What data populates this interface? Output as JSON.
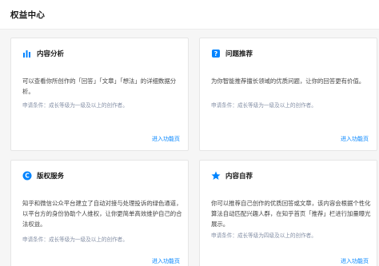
{
  "header": {
    "title": "权益中心"
  },
  "cards": [
    {
      "title": "内容分析",
      "icon": "bar-chart-icon",
      "desc": "可以查看你所创作的「回答」「文章」「想法」的详细数据分析。",
      "condition": "申请条件：成长等级为一级及以上的创作者。",
      "link": "进入功能页"
    },
    {
      "title": "问题推荐",
      "icon": "question-icon",
      "desc": "为你智能推荐擅长领域的优质问题，让你的回答更有价值。",
      "condition": "申请条件：成长等级为一级及以上的创作者。",
      "link": "进入功能页"
    },
    {
      "title": "版权服务",
      "icon": "copyright-icon",
      "desc": "知乎和微信公众平台建立了自动对接与处理投诉的绿色通道，以平台方的身份协助个人维权，让你更简单高效维护自己的合法权益。",
      "condition": "申请条件：成长等级为一级及以上的创作者。",
      "link": "进入功能页"
    },
    {
      "title": "内容自荐",
      "icon": "star-icon",
      "desc": "你可以推荐自己创作的优质回答或文章，该内容会根据个性化算法自动匹配兴趣人群，在知乎首页「推荐」栏进行加量曝光展示。",
      "condition": "申请条件：成长等级为四级及以上的创作者。",
      "link": "进入功能页"
    }
  ],
  "colors": {
    "accent": "#0084ff",
    "muted": "#8590a6",
    "background": "#f6f6f6"
  }
}
